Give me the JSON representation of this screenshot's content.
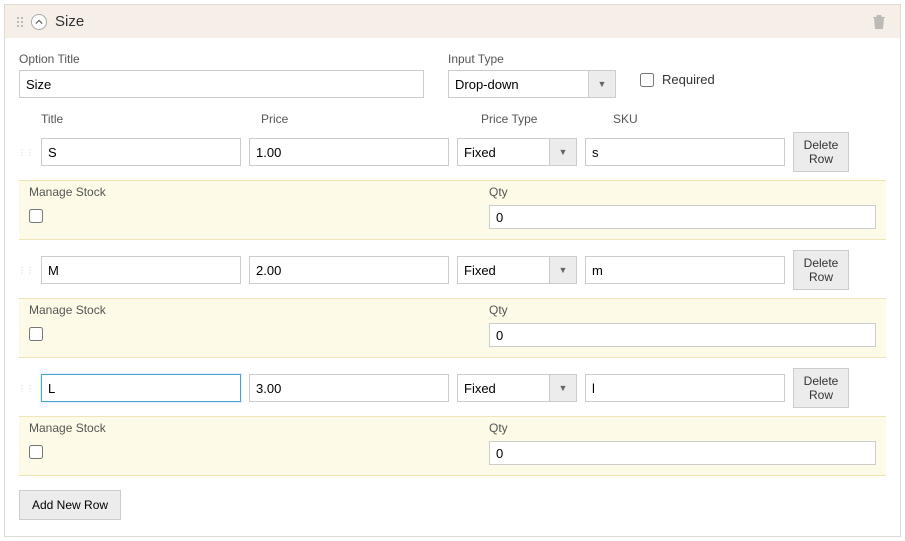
{
  "header": {
    "title": "Size"
  },
  "labels": {
    "option_title": "Option Title",
    "input_type": "Input Type",
    "required": "Required",
    "col_title": "Title",
    "col_price": "Price",
    "col_price_type": "Price Type",
    "col_sku": "SKU",
    "manage_stock": "Manage Stock",
    "qty": "Qty",
    "delete_row": "Delete Row",
    "add_new_row": "Add New Row"
  },
  "option": {
    "title_value": "Size",
    "input_type_value": "Drop-down",
    "required_checked": false
  },
  "rows": [
    {
      "title": "S",
      "price": "1.00",
      "price_type": "Fixed",
      "sku": "s",
      "manage_stock": false,
      "qty": "0",
      "focused": false
    },
    {
      "title": "M",
      "price": "2.00",
      "price_type": "Fixed",
      "sku": "m",
      "manage_stock": false,
      "qty": "0",
      "focused": false
    },
    {
      "title": "L",
      "price": "3.00",
      "price_type": "Fixed",
      "sku": "l",
      "manage_stock": false,
      "qty": "0",
      "focused": true
    }
  ]
}
